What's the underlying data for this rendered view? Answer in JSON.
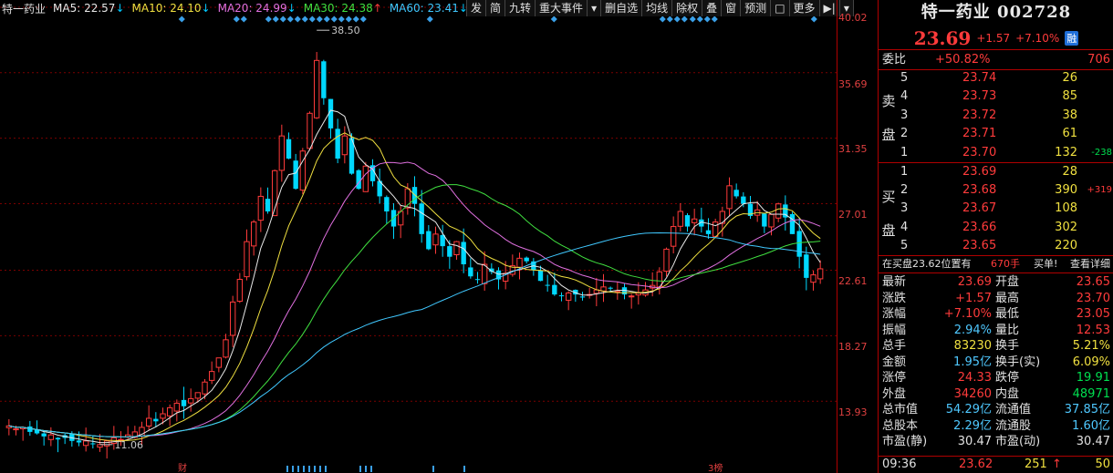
{
  "legend": {
    "name": "特一药业",
    "ma5": {
      "label": "MA5: 22.57",
      "arrow": "↓",
      "color": "#e8e8e8"
    },
    "ma10": {
      "label": "MA10: 24.10",
      "arrow": "↓",
      "color": "#f0e040"
    },
    "ma20": {
      "label": "MA20: 24.99",
      "arrow": "↓",
      "color": "#e070e0"
    },
    "ma30": {
      "label": "MA30: 24.38",
      "arrow": "↑",
      "color": "#40e040"
    },
    "ma60": {
      "label": "MA60: 23.41",
      "arrow": "↓",
      "color": "#40c8ff"
    }
  },
  "toolbar": [
    "发",
    "简",
    "九转",
    "重大事件",
    "▾",
    "删自选",
    "均线",
    "除权",
    "叠",
    "窗",
    "预测",
    "□",
    "更多",
    "▶|",
    "▾"
  ],
  "price_axis": [
    "40.02",
    "35.69",
    "31.35",
    "27.01",
    "22.61",
    "18.27",
    "13.93"
  ],
  "chart_annotations": {
    "high": "38.50",
    "low": "11.06",
    "bottom_marker_1": "财",
    "bottom_marker_2": "3榜"
  },
  "chart_data": {
    "type": "candlestick",
    "ylim": [
      9.6,
      40.02
    ],
    "y_ticks": [
      40.02,
      35.69,
      31.35,
      27.01,
      22.61,
      18.27,
      13.93
    ],
    "series_colors": {
      "up": "#ff3b3b",
      "down": "#00d8ff",
      "ma5": "#e8e8e8",
      "ma10": "#f0e040",
      "ma20": "#e070e0",
      "ma30": "#40e040",
      "ma60": "#40c8ff"
    },
    "close": [
      12.3,
      12.1,
      12.2,
      11.9,
      11.8,
      11.6,
      11.7,
      11.4,
      11.5,
      11.3,
      11.2,
      11.3,
      11.1,
      11.06,
      11.3,
      11.5,
      11.4,
      11.7,
      11.9,
      12.2,
      12.8,
      12.6,
      13.1,
      13.5,
      13.8,
      13.6,
      14.1,
      14.5,
      15.2,
      15.9,
      16.8,
      18.0,
      20.5,
      22.0,
      24.5,
      25.8,
      27.5,
      26.5,
      29.2,
      31.5,
      30.0,
      28.0,
      30.5,
      33.0,
      36.5,
      34.0,
      32.0,
      30.0,
      31.5,
      29.0,
      28.0,
      29.5,
      28.5,
      27.5,
      26.5,
      25.5,
      26.5,
      28.0,
      27.0,
      25.0,
      24.0,
      25.0,
      24.2,
      23.5,
      24.5,
      23.0,
      22.2,
      22.0,
      23.0,
      22.5,
      22.0,
      22.4,
      22.9,
      23.4,
      23.2,
      22.6,
      21.9,
      21.6,
      21.0,
      20.9,
      21.1,
      21.0,
      20.8,
      21.0,
      21.3,
      21.5,
      21.4,
      21.2,
      21.0,
      20.9,
      21.1,
      21.3,
      21.6,
      22.5,
      24.0,
      25.5,
      26.5,
      25.5,
      26.0,
      25.5,
      25.0,
      25.8,
      26.5,
      28.2,
      27.5,
      27.0,
      26.2,
      26.6,
      25.5,
      26.3,
      27.0,
      26.1,
      25.0,
      23.5,
      22.1,
      22.3,
      22.7
    ]
  },
  "right_panel": {
    "title": "特一药业 002728",
    "last": "23.69",
    "change": "+1.57",
    "pct": "+7.10%",
    "rong": "融",
    "weibi": {
      "label": "委比",
      "value": "+50.82%",
      "extra": "706"
    },
    "sell_label": "卖盘",
    "buy_label": "买盘",
    "asks": [
      {
        "level": "5",
        "price": "23.74",
        "vol": "26",
        "chg": ""
      },
      {
        "level": "4",
        "price": "23.73",
        "vol": "85",
        "chg": ""
      },
      {
        "level": "3",
        "price": "23.72",
        "vol": "38",
        "chg": ""
      },
      {
        "level": "2",
        "price": "23.71",
        "vol": "61",
        "chg": ""
      },
      {
        "level": "1",
        "price": "23.70",
        "vol": "132",
        "chg": "-238"
      }
    ],
    "bids": [
      {
        "level": "1",
        "price": "23.69",
        "vol": "28",
        "chg": ""
      },
      {
        "level": "2",
        "price": "23.68",
        "vol": "390",
        "chg": "+319"
      },
      {
        "level": "3",
        "price": "23.67",
        "vol": "108",
        "chg": ""
      },
      {
        "level": "4",
        "price": "23.66",
        "vol": "302",
        "chg": ""
      },
      {
        "level": "5",
        "price": "23.65",
        "vol": "220",
        "chg": ""
      }
    ],
    "order_bar": {
      "text_a": "在买盘23.62位置有",
      "vol": "670手",
      "text_b": "买单!",
      "link": "查看详细"
    },
    "stats": [
      {
        "l1": "最新",
        "v1": "23.69",
        "c1": "red",
        "l2": "开盘",
        "v2": "23.65",
        "c2": "red"
      },
      {
        "l1": "涨跌",
        "v1": "+1.57",
        "c1": "red",
        "l2": "最高",
        "v2": "23.70",
        "c2": "red"
      },
      {
        "l1": "涨幅",
        "v1": "+7.10%",
        "c1": "red",
        "l2": "最低",
        "v2": "23.05",
        "c2": "red"
      },
      {
        "l1": "振幅",
        "v1": "2.94%",
        "c1": "cyan",
        "l2": "量比",
        "v2": "12.53",
        "c2": "red"
      },
      {
        "l1": "总手",
        "v1": "83230",
        "c1": "yellow",
        "l2": "换手",
        "v2": "5.21%",
        "c2": "yellow"
      },
      {
        "l1": "金额",
        "v1": "1.95亿",
        "c1": "cyan",
        "l2": "换手(实)",
        "v2": "6.09%",
        "c2": "yellow"
      },
      {
        "l1": "涨停",
        "v1": "24.33",
        "c1": "red",
        "l2": "跌停",
        "v2": "19.91",
        "c2": "green"
      },
      {
        "l1": "外盘",
        "v1": "34260",
        "c1": "red",
        "l2": "内盘",
        "v2": "48971",
        "c2": "green"
      },
      {
        "l1": "总市值",
        "v1": "54.29亿",
        "c1": "cyan",
        "l2": "流通值",
        "v2": "37.85亿",
        "c2": "cyan"
      },
      {
        "l1": "总股本",
        "v1": "2.29亿",
        "c1": "cyan",
        "l2": "流通股",
        "v2": "1.60亿",
        "c2": "cyan"
      },
      {
        "l1": "市盈(静)",
        "v1": "30.47",
        "c1": "white",
        "l2": "市盈(动)",
        "v2": "30.47",
        "c2": "white"
      }
    ],
    "tick": {
      "time": "09:36",
      "price": "23.62",
      "vol": "251",
      "arrow": "↑",
      "count": "50"
    }
  }
}
